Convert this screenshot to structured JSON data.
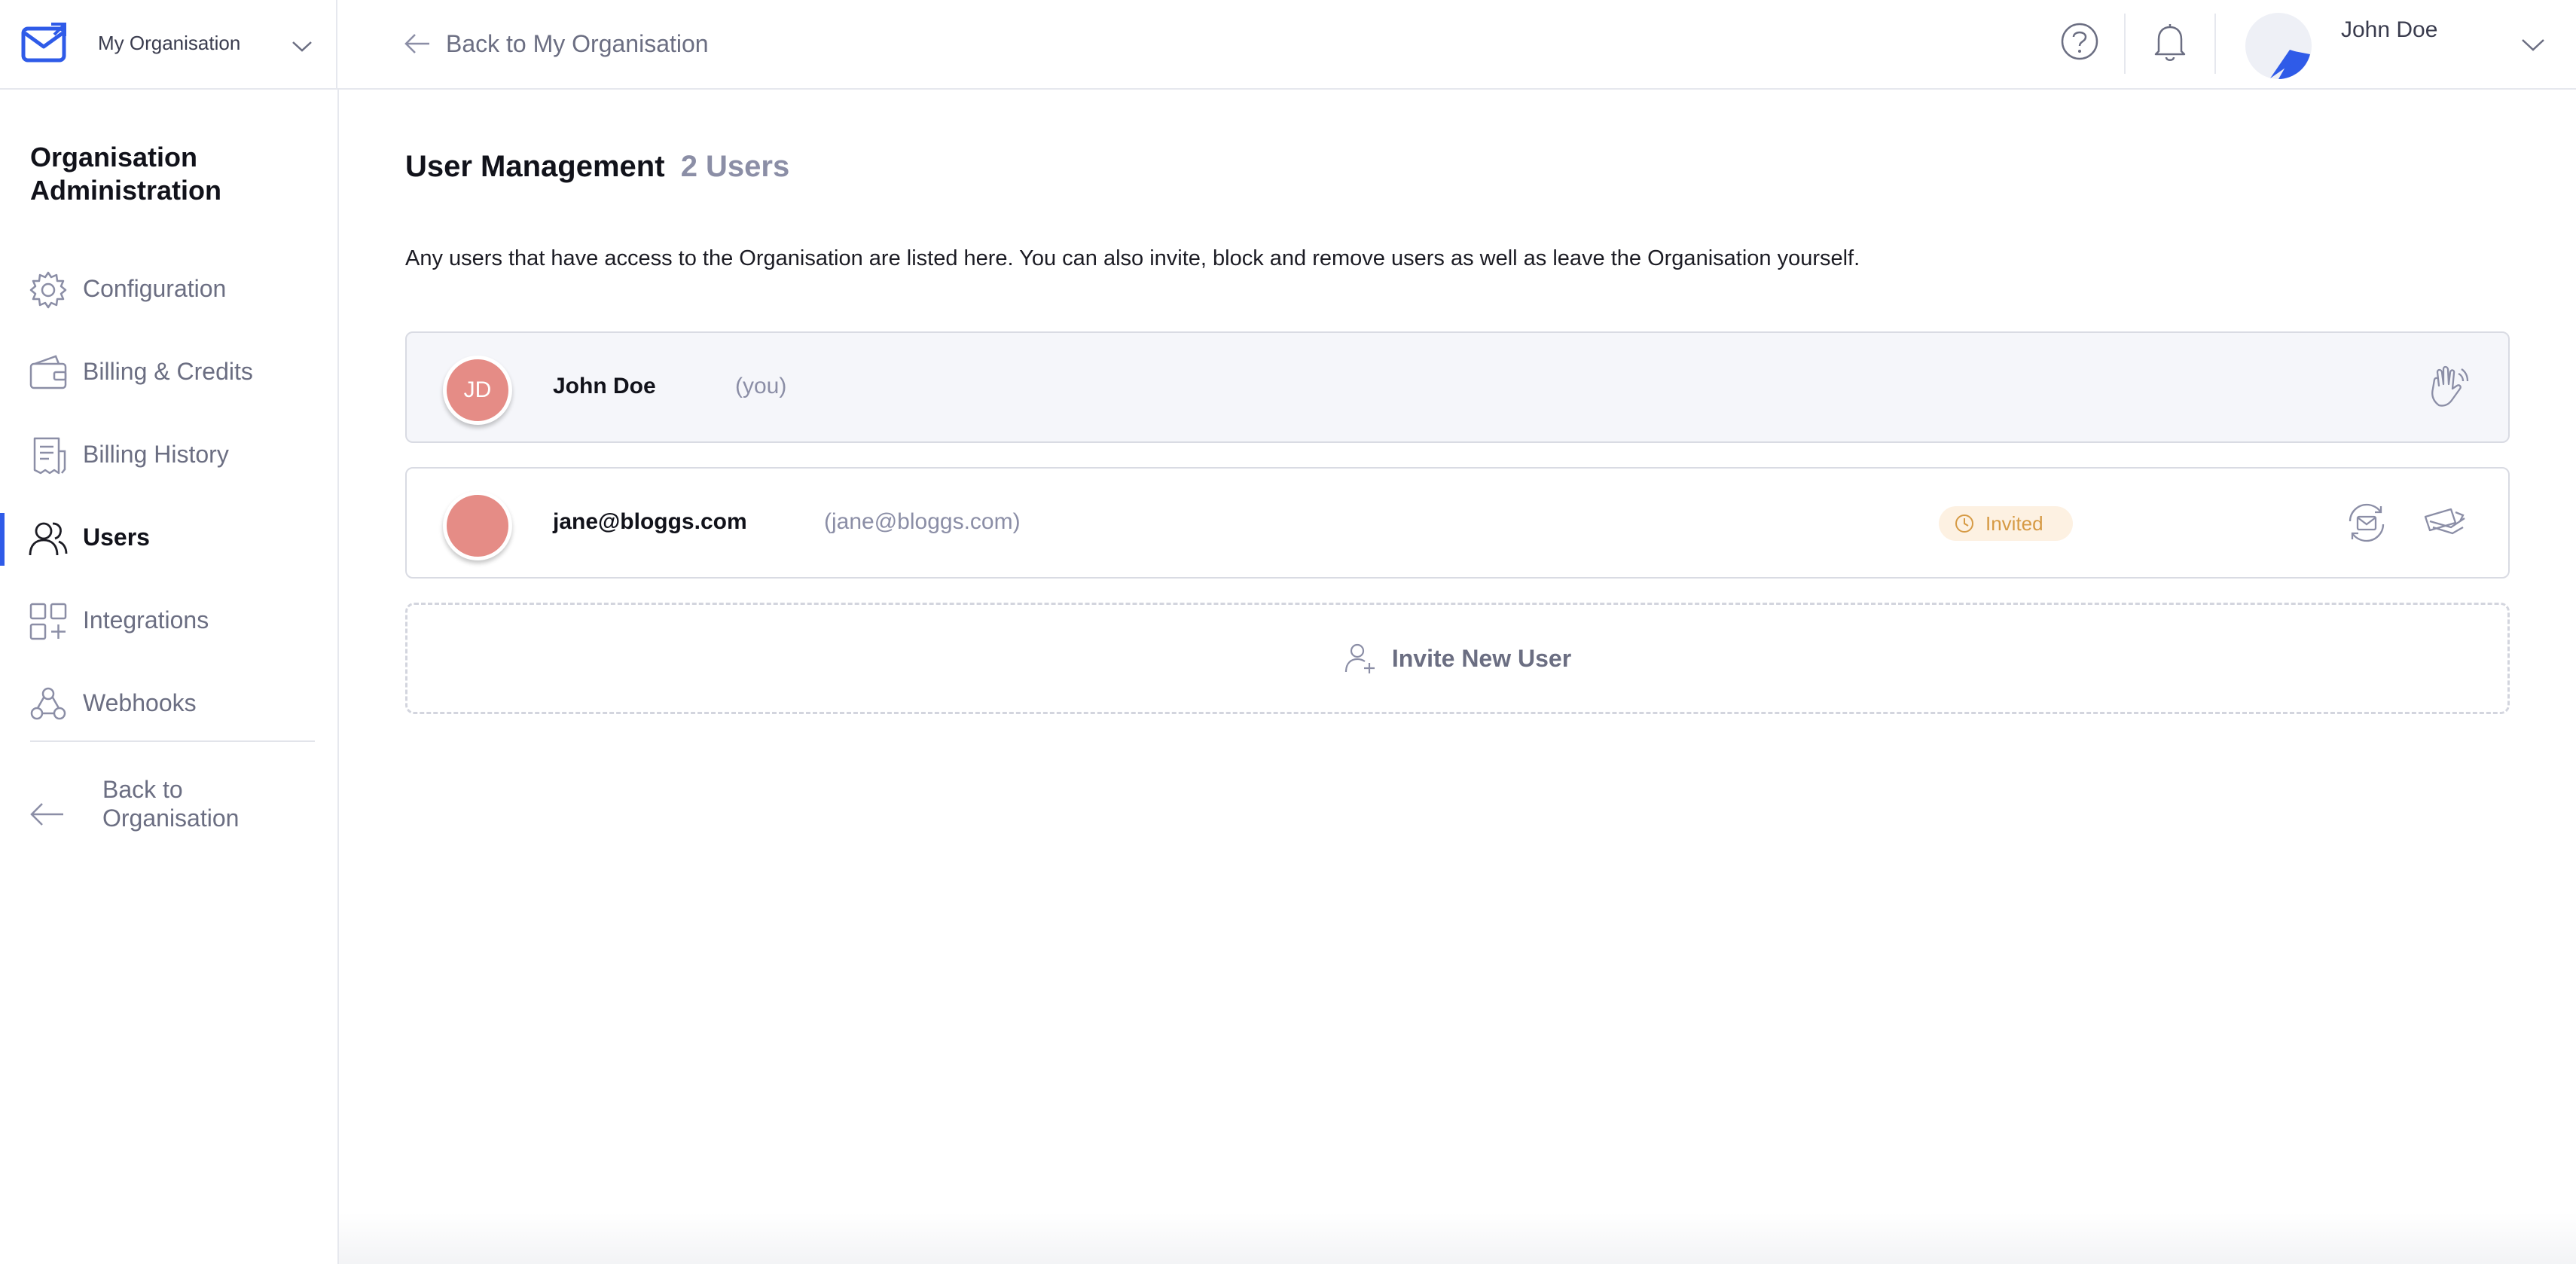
{
  "topbar": {
    "org_name": "My Organisation",
    "back_label": "Back to My Organisation",
    "user_name": "John Doe"
  },
  "sidebar": {
    "title": "Organisation Administration",
    "items": [
      {
        "label": "Configuration",
        "icon": "gear-icon"
      },
      {
        "label": "Billing & Credits",
        "icon": "wallet-icon"
      },
      {
        "label": "Billing History",
        "icon": "receipt-icon"
      },
      {
        "label": "Users",
        "icon": "users-icon",
        "active": true
      },
      {
        "label": "Integrations",
        "icon": "integrations-icon"
      },
      {
        "label": "Webhooks",
        "icon": "webhook-icon"
      }
    ],
    "back_label": "Back to Organisation"
  },
  "main": {
    "title": "User Management",
    "count": "2 Users",
    "description": "Any users that have access to the Organisation are listed here. You can also invite, block and remove users as well as leave the Organisation yourself.",
    "users": [
      {
        "initials": "JD",
        "name": "John Doe",
        "sub": "(you)",
        "actions": [
          "wave-icon"
        ]
      },
      {
        "initials": "",
        "name": "jane@bloggs.com",
        "sub": "(jane@bloggs.com)",
        "status": "Invited",
        "actions": [
          "resend-invite-icon",
          "revoke-invite-icon"
        ]
      }
    ],
    "invite_label": "Invite New User"
  },
  "colors": {
    "accent": "#2f5be8",
    "avatar": "#e58c86",
    "invited_badge_bg": "#fdf1e2",
    "invited_badge_text": "#d69a44",
    "muted_text": "#8b8ea6"
  }
}
